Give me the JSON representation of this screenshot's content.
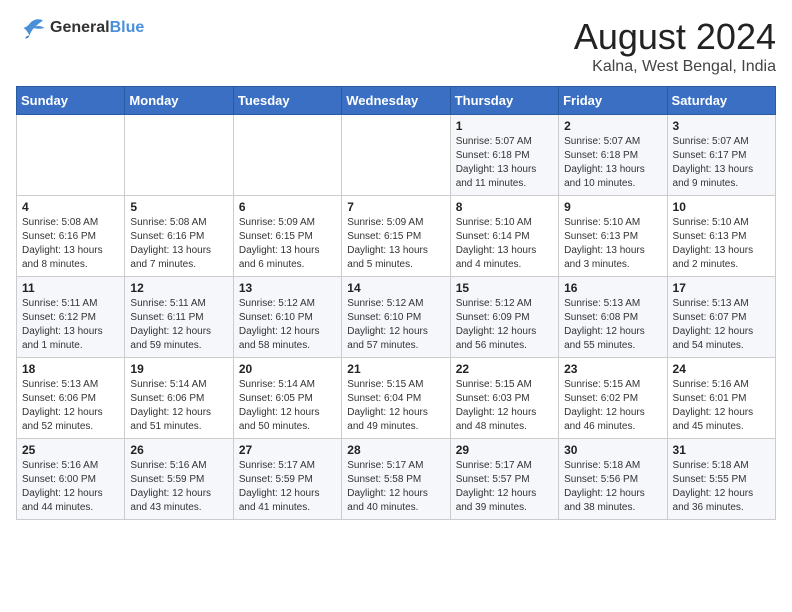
{
  "logo": {
    "line1": "General",
    "line2": "Blue"
  },
  "title": "August 2024",
  "subtitle": "Kalna, West Bengal, India",
  "weekdays": [
    "Sunday",
    "Monday",
    "Tuesday",
    "Wednesday",
    "Thursday",
    "Friday",
    "Saturday"
  ],
  "weeks": [
    [
      {
        "day": "",
        "info": ""
      },
      {
        "day": "",
        "info": ""
      },
      {
        "day": "",
        "info": ""
      },
      {
        "day": "",
        "info": ""
      },
      {
        "day": "1",
        "info": "Sunrise: 5:07 AM\nSunset: 6:18 PM\nDaylight: 13 hours and 11 minutes."
      },
      {
        "day": "2",
        "info": "Sunrise: 5:07 AM\nSunset: 6:18 PM\nDaylight: 13 hours and 10 minutes."
      },
      {
        "day": "3",
        "info": "Sunrise: 5:07 AM\nSunset: 6:17 PM\nDaylight: 13 hours and 9 minutes."
      }
    ],
    [
      {
        "day": "4",
        "info": "Sunrise: 5:08 AM\nSunset: 6:16 PM\nDaylight: 13 hours and 8 minutes."
      },
      {
        "day": "5",
        "info": "Sunrise: 5:08 AM\nSunset: 6:16 PM\nDaylight: 13 hours and 7 minutes."
      },
      {
        "day": "6",
        "info": "Sunrise: 5:09 AM\nSunset: 6:15 PM\nDaylight: 13 hours and 6 minutes."
      },
      {
        "day": "7",
        "info": "Sunrise: 5:09 AM\nSunset: 6:15 PM\nDaylight: 13 hours and 5 minutes."
      },
      {
        "day": "8",
        "info": "Sunrise: 5:10 AM\nSunset: 6:14 PM\nDaylight: 13 hours and 4 minutes."
      },
      {
        "day": "9",
        "info": "Sunrise: 5:10 AM\nSunset: 6:13 PM\nDaylight: 13 hours and 3 minutes."
      },
      {
        "day": "10",
        "info": "Sunrise: 5:10 AM\nSunset: 6:13 PM\nDaylight: 13 hours and 2 minutes."
      }
    ],
    [
      {
        "day": "11",
        "info": "Sunrise: 5:11 AM\nSunset: 6:12 PM\nDaylight: 13 hours and 1 minute."
      },
      {
        "day": "12",
        "info": "Sunrise: 5:11 AM\nSunset: 6:11 PM\nDaylight: 12 hours and 59 minutes."
      },
      {
        "day": "13",
        "info": "Sunrise: 5:12 AM\nSunset: 6:10 PM\nDaylight: 12 hours and 58 minutes."
      },
      {
        "day": "14",
        "info": "Sunrise: 5:12 AM\nSunset: 6:10 PM\nDaylight: 12 hours and 57 minutes."
      },
      {
        "day": "15",
        "info": "Sunrise: 5:12 AM\nSunset: 6:09 PM\nDaylight: 12 hours and 56 minutes."
      },
      {
        "day": "16",
        "info": "Sunrise: 5:13 AM\nSunset: 6:08 PM\nDaylight: 12 hours and 55 minutes."
      },
      {
        "day": "17",
        "info": "Sunrise: 5:13 AM\nSunset: 6:07 PM\nDaylight: 12 hours and 54 minutes."
      }
    ],
    [
      {
        "day": "18",
        "info": "Sunrise: 5:13 AM\nSunset: 6:06 PM\nDaylight: 12 hours and 52 minutes."
      },
      {
        "day": "19",
        "info": "Sunrise: 5:14 AM\nSunset: 6:06 PM\nDaylight: 12 hours and 51 minutes."
      },
      {
        "day": "20",
        "info": "Sunrise: 5:14 AM\nSunset: 6:05 PM\nDaylight: 12 hours and 50 minutes."
      },
      {
        "day": "21",
        "info": "Sunrise: 5:15 AM\nSunset: 6:04 PM\nDaylight: 12 hours and 49 minutes."
      },
      {
        "day": "22",
        "info": "Sunrise: 5:15 AM\nSunset: 6:03 PM\nDaylight: 12 hours and 48 minutes."
      },
      {
        "day": "23",
        "info": "Sunrise: 5:15 AM\nSunset: 6:02 PM\nDaylight: 12 hours and 46 minutes."
      },
      {
        "day": "24",
        "info": "Sunrise: 5:16 AM\nSunset: 6:01 PM\nDaylight: 12 hours and 45 minutes."
      }
    ],
    [
      {
        "day": "25",
        "info": "Sunrise: 5:16 AM\nSunset: 6:00 PM\nDaylight: 12 hours and 44 minutes."
      },
      {
        "day": "26",
        "info": "Sunrise: 5:16 AM\nSunset: 5:59 PM\nDaylight: 12 hours and 43 minutes."
      },
      {
        "day": "27",
        "info": "Sunrise: 5:17 AM\nSunset: 5:59 PM\nDaylight: 12 hours and 41 minutes."
      },
      {
        "day": "28",
        "info": "Sunrise: 5:17 AM\nSunset: 5:58 PM\nDaylight: 12 hours and 40 minutes."
      },
      {
        "day": "29",
        "info": "Sunrise: 5:17 AM\nSunset: 5:57 PM\nDaylight: 12 hours and 39 minutes."
      },
      {
        "day": "30",
        "info": "Sunrise: 5:18 AM\nSunset: 5:56 PM\nDaylight: 12 hours and 38 minutes."
      },
      {
        "day": "31",
        "info": "Sunrise: 5:18 AM\nSunset: 5:55 PM\nDaylight: 12 hours and 36 minutes."
      }
    ]
  ]
}
